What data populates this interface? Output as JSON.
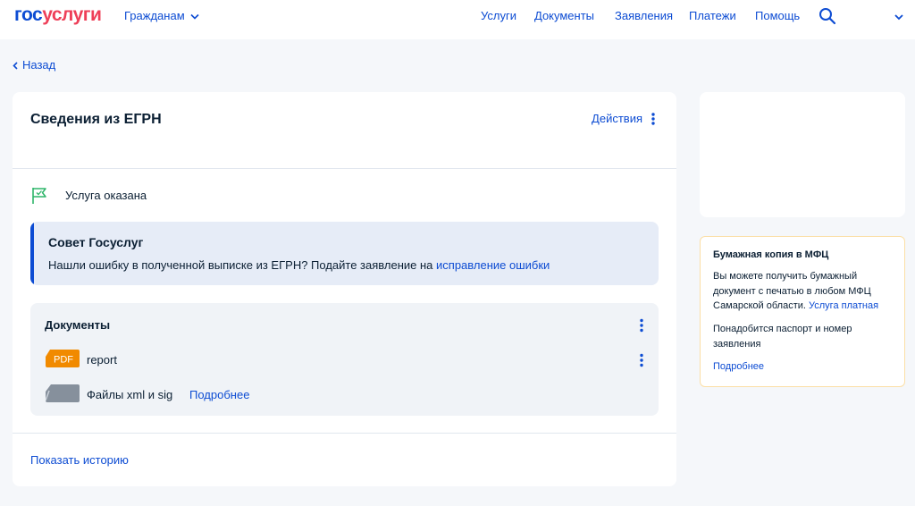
{
  "header": {
    "logo_part1": "гос",
    "logo_part2": "услуги",
    "audience": "Гражданам",
    "nav": [
      "Услуги",
      "Документы",
      "Заявления",
      "Платежи",
      "Помощь"
    ]
  },
  "back_label": "Назад",
  "card": {
    "title": "Сведения из ЕГРН",
    "actions_label": "Действия",
    "status": "Услуга оказана",
    "tip": {
      "title": "Совет Госуслуг",
      "text": "Нашли ошибку в полученной выписке из ЕГРН? Подайте заявление на ",
      "link": "исправление ошибки"
    },
    "documents": {
      "title": "Документы",
      "pdf_badge": "PDF",
      "doc_name": "report",
      "files_label": "Файлы xml и sig",
      "files_more": "Подробнее"
    },
    "history_link": "Показать историю"
  },
  "mfc": {
    "title": "Бумажная копия в МФЦ",
    "text": "Вы можете получить бумажный документ с печатью в любом МФЦ Самарской области. ",
    "text_link": "Услуга платная",
    "text2": "Понадобится паспорт и номер заявления",
    "more": "Подробнее"
  },
  "colors": {
    "accent": "#0d4cd3",
    "logo_red": "#ee3f58",
    "pdf_orange": "#f18a00",
    "status_green": "#2fb56a",
    "mfc_border": "#fbdfa6"
  }
}
